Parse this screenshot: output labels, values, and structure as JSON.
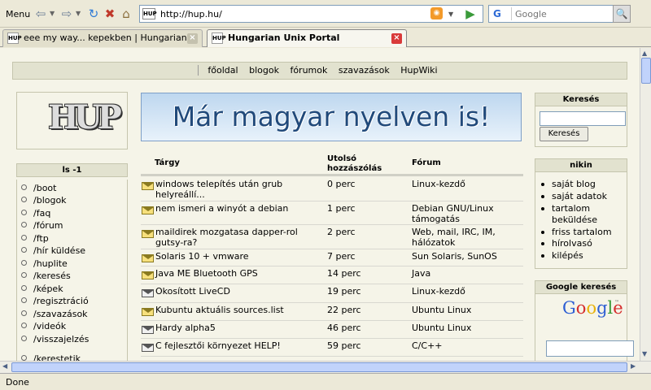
{
  "browser": {
    "menu_label": "Menu",
    "url": "http://hup.hu/",
    "search_engine_letter": "G",
    "search_placeholder": "Google",
    "tabs": [
      {
        "label": "eee my way... kepekben | Hungarian ...",
        "active": false
      },
      {
        "label": "Hungarian Unix Portal",
        "active": true
      }
    ],
    "status_text": "Done"
  },
  "site": {
    "logo_text": "HUP",
    "banner_text": "Már magyar nyelven is!",
    "nav": [
      "főoldal",
      "blogok",
      "fórumok",
      "szavazások",
      "HupWiki"
    ],
    "ls_block": {
      "title": "ls -1",
      "items": [
        "/boot",
        "/blogok",
        "/faq",
        "/fórum",
        "/ftp",
        "/hír küldése",
        "/huplite",
        "/keresés",
        "/képek",
        "/regisztráció",
        "/szavazások",
        "/videók",
        "/visszajelzés",
        "/kerestetik"
      ]
    },
    "forum_table": {
      "headers": {
        "subject": "Tárgy",
        "last": "Utolsó hozzászólás",
        "forum": "Fórum"
      },
      "rows": [
        {
          "subject": "windows telepítés után grub helyreállí...",
          "last": "0 perc",
          "forum": "Linux-kezdő",
          "icon": "envelope-icon"
        },
        {
          "subject": "nem ismeri a winyót a debian",
          "last": "1 perc",
          "forum": "Debian GNU/Linux támogatás",
          "icon": "envelope-icon"
        },
        {
          "subject": "maildirek mozgatasa dapper-rol gutsy-ra?",
          "last": "2 perc",
          "forum": "Web, mail, IRC, IM, hálózatok",
          "icon": "envelope-icon"
        },
        {
          "subject": "Solaris 10 + vmware",
          "last": "7 perc",
          "forum": "Sun Solaris, SunOS",
          "icon": "envelope-icon"
        },
        {
          "subject": "Java ME Bluetooth GPS",
          "last": "14 perc",
          "forum": "Java",
          "icon": "envelope-icon"
        },
        {
          "subject": "Okosított LiveCD",
          "last": "19 perc",
          "forum": "Linux-kezdő",
          "icon": "hot-envelope-icon"
        },
        {
          "subject": "Kubuntu aktuális sources.list",
          "last": "22 perc",
          "forum": "Ubuntu Linux",
          "icon": "envelope-icon"
        },
        {
          "subject": "Hardy alpha5",
          "last": "46 perc",
          "forum": "Ubuntu Linux",
          "icon": "hot-envelope-icon"
        },
        {
          "subject": "C fejlesztői környezet HELP!",
          "last": "59 perc",
          "forum": "C/C++",
          "icon": "hot-envelope-icon"
        }
      ]
    },
    "search_block": {
      "title": "Keresés",
      "button": "Keresés"
    },
    "user_block": {
      "title": "nikin",
      "items": [
        "saját blog",
        "saját adatok",
        "tartalom beküldése",
        "friss tartalom",
        "hírolvasó",
        "kilépés"
      ]
    },
    "google_block": {
      "title": "Google keresés",
      "logo": "Google"
    }
  }
}
